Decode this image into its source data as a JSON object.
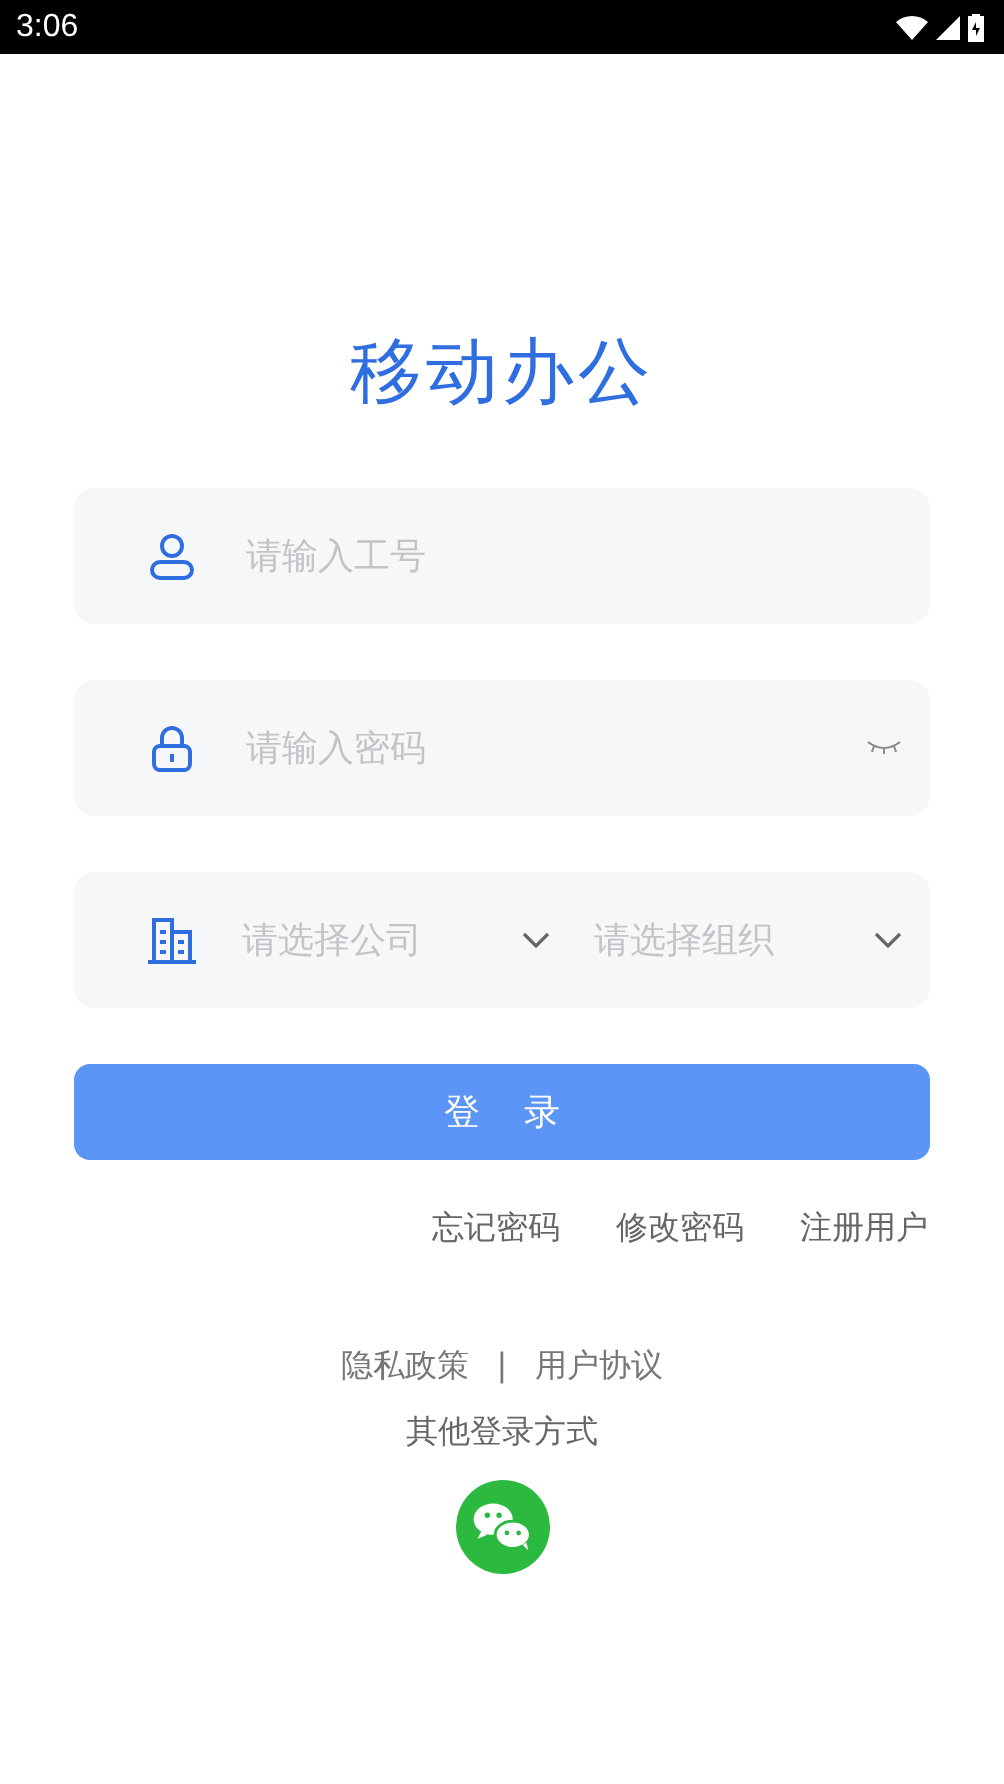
{
  "status_bar": {
    "time": "3:06"
  },
  "title": "移动办公",
  "fields": [
    {
      "kind": "user",
      "placeholder": "请输入工号"
    },
    {
      "kind": "password",
      "placeholder": "请输入密码",
      "password_visible": false
    }
  ],
  "selects": [
    {
      "placeholder": "请选择公司"
    },
    {
      "placeholder": "请选择组织"
    }
  ],
  "login_button": "登录",
  "links": [
    "忘记密码",
    "修改密码",
    "注册用户"
  ],
  "policy": {
    "privacy": "隐私政策",
    "separator": "|",
    "agreement": "用户协议"
  },
  "other_login": "其他登录方式"
}
